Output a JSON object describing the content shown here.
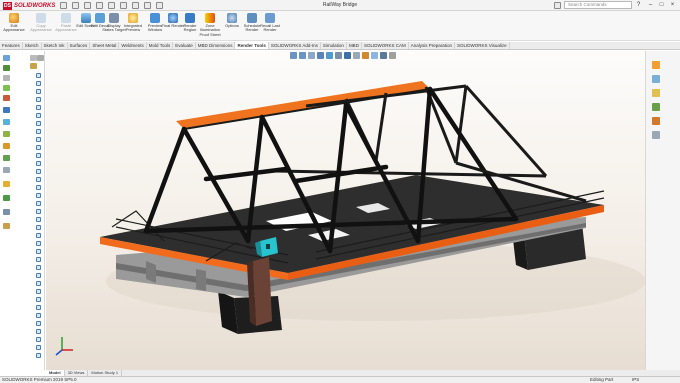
{
  "app": {
    "brand": "SOLIDWORKS",
    "doc_title": "RailWay Bridge"
  },
  "search": {
    "placeholder": "Search Commands"
  },
  "ribbon": {
    "buttons": [
      {
        "label": "Edit Appearance",
        "enabled": true
      },
      {
        "label": "Copy Appearance",
        "enabled": false
      },
      {
        "label": "Paste Appearance",
        "enabled": false
      },
      {
        "label": "Edit Scene",
        "enabled": true
      },
      {
        "label": "Edit Decal",
        "enabled": true
      },
      {
        "label": "Display States Target",
        "enabled": true
      },
      {
        "label": "Integrated Preview",
        "enabled": true
      },
      {
        "label": "Preview Window",
        "enabled": true
      },
      {
        "label": "Final Render",
        "enabled": true
      },
      {
        "label": "Render Region",
        "enabled": true
      },
      {
        "label": "Zone Illumination Proof Sheet",
        "enabled": true
      },
      {
        "label": "Options",
        "enabled": true
      },
      {
        "label": "Schedule Render",
        "enabled": true
      },
      {
        "label": "Recall Last Render",
        "enabled": true
      }
    ]
  },
  "tabs": [
    {
      "label": "Features",
      "active": false
    },
    {
      "label": "Sketch",
      "active": false
    },
    {
      "label": "Sketch Ink",
      "active": false
    },
    {
      "label": "Surfaces",
      "active": false
    },
    {
      "label": "Sheet Metal",
      "active": false
    },
    {
      "label": "Weldments",
      "active": false
    },
    {
      "label": "Mold Tools",
      "active": false
    },
    {
      "label": "Evaluate",
      "active": false
    },
    {
      "label": "MBD Dimensions",
      "active": false
    },
    {
      "label": "Render Tools",
      "active": true
    },
    {
      "label": "SOLIDWORKS Add-Ins",
      "active": false
    },
    {
      "label": "Simulation",
      "active": false
    },
    {
      "label": "MBD",
      "active": false
    },
    {
      "label": "SOLIDWORKS CAM",
      "active": false
    },
    {
      "label": "Analysis Preparation",
      "active": false
    },
    {
      "label": "SOLIDWORKS Visualize",
      "active": false
    }
  ],
  "model_tabs": [
    {
      "label": "Model",
      "active": true
    },
    {
      "label": "3D Views",
      "active": false
    },
    {
      "label": "Motion Study 1",
      "active": false
    }
  ],
  "status": {
    "left": "SOLIDWORKS Premium 2019 SP5.0",
    "mode": "Editing Part",
    "units": "IPS"
  },
  "colors": {
    "accent": "#c8102e",
    "deck_edge": "#f26b1d",
    "steel": "#1c1c1c",
    "concrete": "#c9c9c9"
  }
}
